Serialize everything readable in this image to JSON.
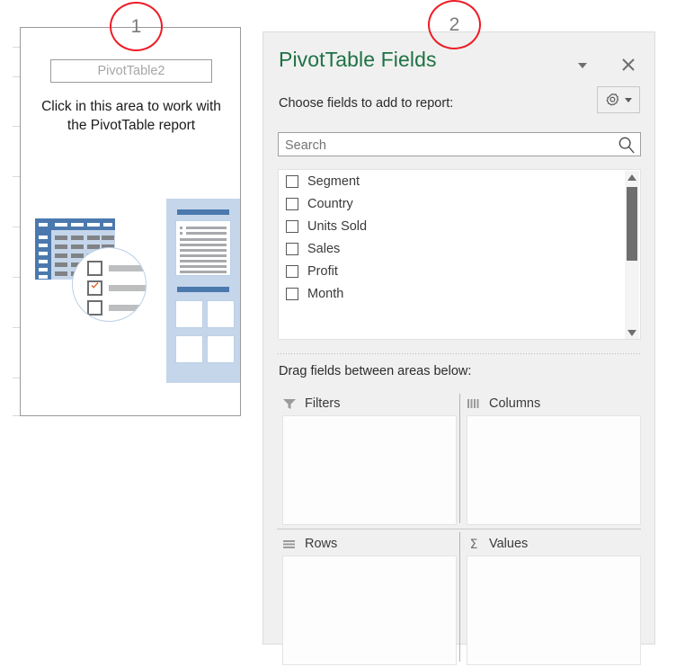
{
  "callouts": [
    {
      "id": "1",
      "label": "1"
    },
    {
      "id": "2",
      "label": "2"
    }
  ],
  "pivot_placeholder": {
    "name_box_value": "PivotTable2",
    "hint_line1": "Click in this area to work with",
    "hint_line2": "the PivotTable report",
    "hint_text": "Click in this area to work with the PivotTable report",
    "illustration_name": "pivottable-illustration"
  },
  "fields_pane": {
    "title": "PivotTable Fields",
    "title_color": "#1e7145",
    "dropdown_icon": "chevron-down-icon",
    "close_icon": "close-icon",
    "choose_label": "Choose fields to add to report:",
    "options_button": {
      "icon": "gear-icon",
      "chevron": "chevron-down-icon"
    },
    "search": {
      "placeholder": "Search",
      "value": "",
      "icon": "search-icon"
    },
    "field_list": {
      "items": [
        {
          "label": "Segment",
          "checked": false
        },
        {
          "label": "Country",
          "checked": false
        },
        {
          "label": "Units Sold",
          "checked": false
        },
        {
          "label": "Sales",
          "checked": false
        },
        {
          "label": "Profit",
          "checked": false
        },
        {
          "label": "Month",
          "checked": false
        }
      ],
      "scrollbar": {
        "up_arrow": "triangle-up-icon",
        "down_arrow": "triangle-down-icon"
      }
    },
    "drag_label": "Drag fields between areas below:",
    "drop_zones": [
      {
        "label": "Filters",
        "icon": "filter-funnel-icon",
        "items": []
      },
      {
        "label": "Columns",
        "icon": "columns-icon",
        "items": []
      },
      {
        "label": "Rows",
        "icon": "rows-icon",
        "items": []
      },
      {
        "label": "Values",
        "icon": "sigma-icon",
        "items": []
      }
    ]
  },
  "colors": {
    "excel_green": "#1e7145",
    "callout_red": "#ee1c25",
    "pane_bg": "#f0f0f0",
    "illustration_blue": "#4b79ae",
    "illustration_light_blue": "#c5d6ea",
    "check_orange": "#e2622a"
  }
}
